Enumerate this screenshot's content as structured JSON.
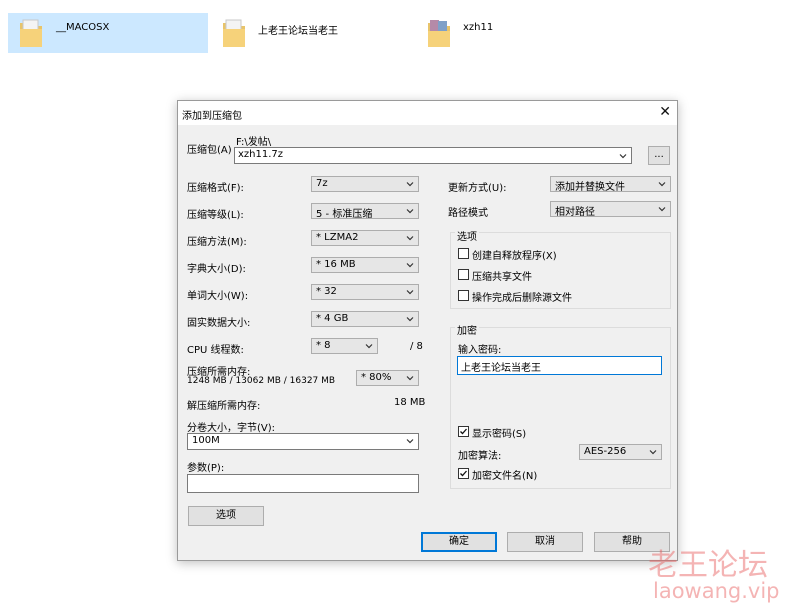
{
  "explorer": {
    "items": [
      {
        "name": "__MACOSX"
      },
      {
        "name": "上老王论坛当老王"
      },
      {
        "name": "xzh11"
      }
    ]
  },
  "dialog": {
    "title": "添加到压缩包",
    "archive": {
      "label": "压缩包(A)",
      "path": "F:\\发帖\\",
      "filename": "xzh11.7z",
      "browse_label": "..."
    },
    "left": {
      "format": {
        "label": "压缩格式(F):",
        "value": "7z"
      },
      "level": {
        "label": "压缩等级(L):",
        "value": "5 - 标准压缩"
      },
      "method": {
        "label": "压缩方法(M):",
        "value": "* LZMA2"
      },
      "dict": {
        "label": "字典大小(D):",
        "value": "* 16 MB"
      },
      "word": {
        "label": "单词大小(W):",
        "value": "* 32"
      },
      "solid": {
        "label": "固实数据大小:",
        "value": "* 4 GB"
      },
      "cpu": {
        "label": "CPU 线程数:",
        "value": "* 8",
        "total": "/ 8"
      },
      "mem": {
        "label": "压缩所需内存:",
        "detail": "1248 MB / 13062 MB / 16327 MB",
        "value": "* 80%"
      },
      "decomp": {
        "label": "解压缩所需内存:",
        "value": "18 MB"
      },
      "volume": {
        "label": "分卷大小，字节(V):",
        "value": "100M"
      },
      "params": {
        "label": "参数(P):",
        "value": ""
      },
      "options_button": "选项"
    },
    "right": {
      "update": {
        "label": "更新方式(U):",
        "value": "添加并替换文件"
      },
      "path_mode": {
        "label": "路径模式",
        "value": "相对路径"
      },
      "options_group": {
        "title": "选项",
        "sfx": "创建自释放程序(X)",
        "shared": "压缩共享文件",
        "delete": "操作完成后删除源文件"
      },
      "encryption": {
        "title": "加密",
        "password_label": "输入密码:",
        "password": "上老王论坛当老王",
        "show_password": "显示密码(S)",
        "method_label": "加密算法:",
        "method_value": "AES-256",
        "encrypt_names": "加密文件名(N)"
      }
    },
    "buttons": {
      "ok": "确定",
      "cancel": "取消",
      "help": "帮助"
    }
  },
  "watermark": {
    "cn": "老王论坛",
    "url": "laowang.vip"
  },
  "colors": {
    "selection": "#cce8ff",
    "accent": "#0078d7",
    "dialog_bg": "#f0f0f0",
    "watermark": "#e85a5a"
  }
}
